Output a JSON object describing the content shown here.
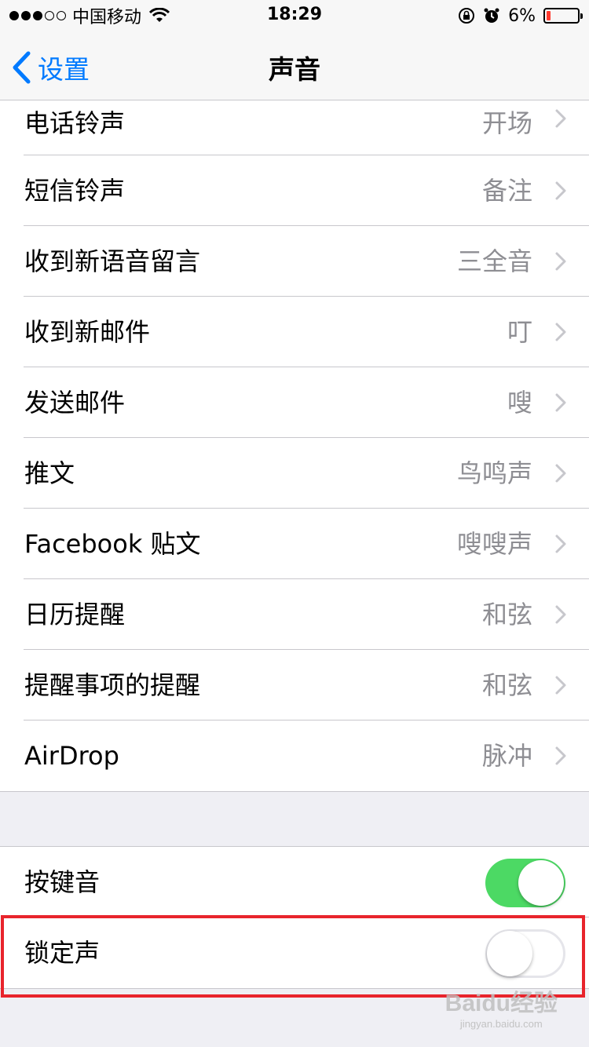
{
  "status_bar": {
    "carrier": "中国移动",
    "time": "18:29",
    "battery_percent": "6%",
    "battery_level": 0.06,
    "battery_color": "#ff3b30",
    "signal_bars_filled": 3,
    "signal_bars_total": 5
  },
  "nav": {
    "back_label": "设置",
    "title": "声音"
  },
  "sounds": [
    {
      "label": "电话铃声",
      "value": "开场"
    },
    {
      "label": "短信铃声",
      "value": "备注"
    },
    {
      "label": "收到新语音留言",
      "value": "三全音"
    },
    {
      "label": "收到新邮件",
      "value": "叮"
    },
    {
      "label": "发送邮件",
      "value": "嗖"
    },
    {
      "label": "推文",
      "value": "鸟鸣声"
    },
    {
      "label": "Facebook 贴文",
      "value": "嗖嗖声"
    },
    {
      "label": "日历提醒",
      "value": "和弦"
    },
    {
      "label": "提醒事项的提醒",
      "value": "和弦"
    },
    {
      "label": "AirDrop",
      "value": "脉冲"
    }
  ],
  "toggles": [
    {
      "label": "按键音",
      "on": true
    },
    {
      "label": "锁定声",
      "on": false
    }
  ],
  "watermark": {
    "brand": "Baidu经验",
    "site": "jingyan.baidu.com"
  },
  "colors": {
    "accent": "#007aff",
    "toggle_on": "#4cd964",
    "highlight": "#e8242c"
  }
}
